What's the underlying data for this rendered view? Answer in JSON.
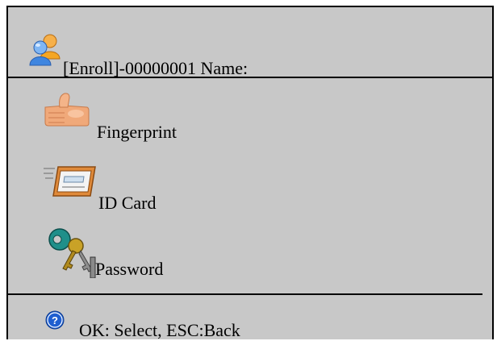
{
  "header": {
    "icon": "users-icon",
    "title": "[Enroll]-00000001 Name:"
  },
  "menu": {
    "items": [
      {
        "id": "fingerprint",
        "icon": "thumbs-up-icon",
        "label": "Fingerprint"
      },
      {
        "id": "id-card",
        "icon": "id-card-icon",
        "label": "ID Card"
      },
      {
        "id": "password",
        "icon": "keys-icon",
        "label": "Password"
      }
    ]
  },
  "footer": {
    "icon": "help-icon",
    "hint": "OK: Select, ESC:Back"
  },
  "colors": {
    "background": "#c8c8c8",
    "text": "#000000",
    "help_blue": "#1f5fd0",
    "card_orange": "#e08a3a",
    "skin": "#f0a97a"
  }
}
